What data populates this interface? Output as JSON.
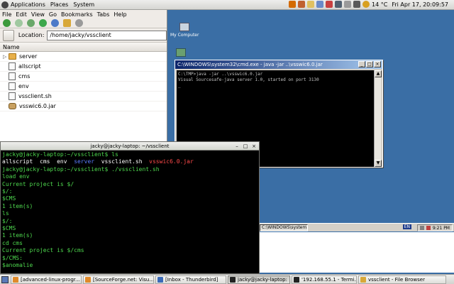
{
  "top_panel": {
    "menus": [
      "Applications",
      "Places",
      "System"
    ],
    "temperature": "14 °C",
    "datetime": "Fri Apr 17, 20:09:57"
  },
  "windows_desktop": {
    "icons": [
      "My Computer",
      "Recycle Bin"
    ],
    "cmd": {
      "title": "C:\\WINDOWS\\system32\\cmd.exe - java -jar ..\\vsswic6.0.jar",
      "lines": [
        "C:\\TMP>java -jar ..\\vsswic6.0.jar",
        "Visual Sourcesafe-java server 1.0, started on port 3130",
        "_"
      ]
    },
    "taskbar": {
      "task": "C:\\WINDOWS\\system...",
      "lang": "EN",
      "clock": "9:21 PM"
    }
  },
  "nautilus": {
    "menu": [
      "File",
      "Edit",
      "View",
      "Go",
      "Bookmarks",
      "Tabs",
      "Help"
    ],
    "location_label": "Location:",
    "location_value": "/home/jacky/vssclient",
    "column_header": "Name",
    "files": [
      {
        "name": "server",
        "kind": "folder"
      },
      {
        "name": "allscript",
        "kind": "file"
      },
      {
        "name": "cms",
        "kind": "file"
      },
      {
        "name": "env",
        "kind": "file"
      },
      {
        "name": "vssclient.sh",
        "kind": "file"
      },
      {
        "name": "vsswic6.0.jar",
        "kind": "jar"
      }
    ]
  },
  "terminal": {
    "title": "jacky@jacky-laptop: ~/vssclient",
    "prompt1": "jacky@jacky-laptop:~/vssclient$ ls",
    "ls_output": [
      "allscript",
      "cms",
      "env",
      "server",
      "vssclient.sh",
      "vsswic6.0.jar"
    ],
    "prompt2": "jacky@jacky-laptop:~/vssclient$ ./vssclient.sh",
    "lines": [
      "load env",
      "Current project is $/",
      "$/:",
      "$CMS",
      "",
      "1 item(s)",
      "ls",
      "$/:",
      "$CMS",
      "",
      "1 item(s)",
      "cd cms",
      "Current project is $/cms",
      "$/CMS:",
      "$anomalie"
    ]
  },
  "bottom_panel": {
    "tasks": [
      "[advanced-linux-progr...",
      "[SourceForge.net: Visu...",
      "[Inbox - Thunderbird]",
      "jacky@jacky-laptop: ...",
      "'192.168.55.1 - Termi...",
      "vssclient - File Browser"
    ],
    "active_index": 3
  },
  "colors": {
    "win_desktop": "#3a6ea5",
    "terminal_green": "#4ed84e",
    "terminal_blue": "#5a7cff",
    "terminal_red": "#ff4a4a"
  }
}
